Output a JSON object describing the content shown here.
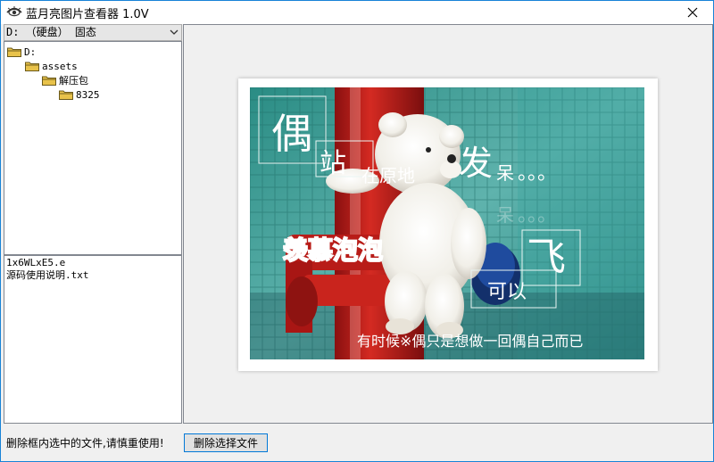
{
  "window": {
    "title": "蓝月亮图片查看器 1.0V",
    "icon": "eye-icon",
    "close_icon": "close-icon"
  },
  "drive_select": {
    "value": "D: （硬盘） 固态",
    "icon": "chevron-down-icon"
  },
  "tree": {
    "items": [
      {
        "label": "D:",
        "depth": 0
      },
      {
        "label": "assets",
        "depth": 1
      },
      {
        "label": "解压包",
        "depth": 2
      },
      {
        "label": "8325",
        "depth": 3
      }
    ],
    "icon": "folder-icon"
  },
  "files": [
    "1x6WLxE5.e",
    "源码使用说明.txt"
  ],
  "photo": {
    "text_1": "偶",
    "text_2": "站",
    "text_3": "在原地",
    "text_4": "发",
    "text_5": "呆",
    "text_6": "。。。",
    "text_7": "羡慕泡泡",
    "text_8": "飞",
    "text_9": "可以",
    "text_10": "有时候※偶只是想做一回偶自己而已"
  },
  "status": {
    "warning": "删除框内选中的文件,请慎重使用!",
    "delete_button": "删除选择文件"
  },
  "colors": {
    "window_border": "#1883d7",
    "button_border": "#0078d7",
    "folder": "#e8c24a"
  }
}
